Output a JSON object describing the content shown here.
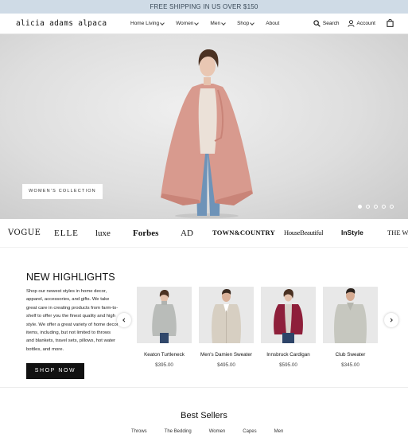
{
  "promo": {
    "text": "FREE SHIPPING IN US OVER $150"
  },
  "header": {
    "logo": "alicia adams alpaca",
    "menu": [
      "Home Living",
      "Women",
      "Men",
      "Shop",
      "About"
    ],
    "search_label": "Search",
    "account_label": "Account",
    "icons": [
      "search-icon",
      "account-icon",
      "bag-icon"
    ]
  },
  "hero": {
    "button_label": "WOMEN'S COLLECTION",
    "slide_count": 5,
    "active_slide": 1
  },
  "press": [
    "VOGUE",
    "ELLE",
    "luxe",
    "Forbes",
    "AD",
    "TOWN&COUNTRY",
    "HouseBeautiful",
    "InStyle",
    "THE WA"
  ],
  "highlights": {
    "title": "NEW HIGHLIGHTS",
    "description": "Shop our newest styles in home decor, apparel, accessories, and gifts. We take great care in creating products from farm-to-shelf to offer you the finest quality and high style. We offer a great variety of home decor items, including, but not limited to throws and blankets, travel sets, pillows, hot water bottles, and more.",
    "cta": "SHOP NOW",
    "products": [
      {
        "name": "Keaton Turtleneck",
        "price": "$395.00"
      },
      {
        "name": "Men's Damien Sweater",
        "price": "$495.00"
      },
      {
        "name": "Innsbruck Cardigan",
        "price": "$595.00"
      },
      {
        "name": "Club Sweater",
        "price": "$345.00"
      }
    ]
  },
  "best_sellers": {
    "title": "Best Sellers",
    "tabs": [
      "Throws",
      "The Bedding",
      "Women",
      "Capes",
      "Men"
    ]
  },
  "colors": {
    "promo_bg": "#cfdbe6",
    "cape": "#d89a8e",
    "cardigan": "#8e1f3a",
    "button_dark": "#111111"
  }
}
